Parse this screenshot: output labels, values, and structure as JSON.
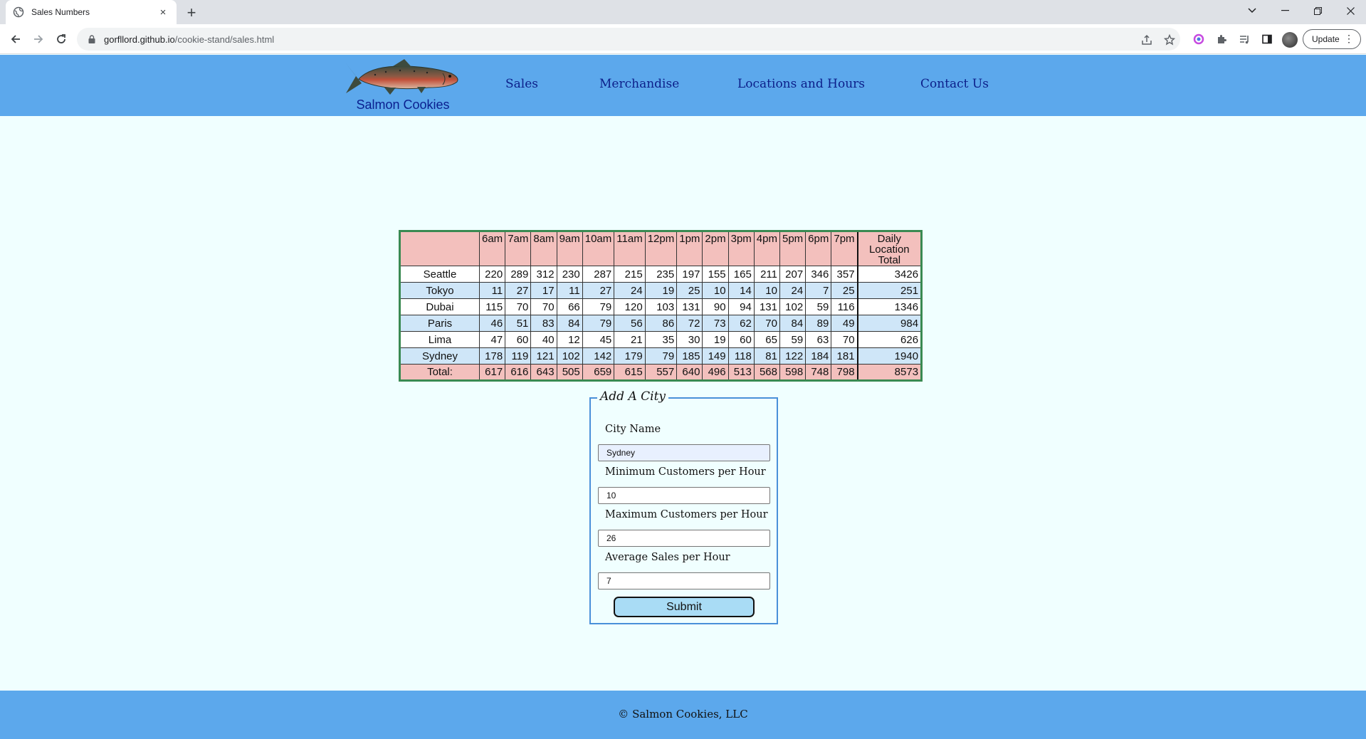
{
  "browser": {
    "tab_title": "Sales Numbers",
    "tab_close": "×",
    "new_tab": "+",
    "url_host": "gorfllord.github.io",
    "url_path": "/cookie-stand/sales.html",
    "update_label": "Update"
  },
  "header": {
    "logo_text": "Salmon Cookies",
    "nav": [
      "Sales",
      "Merchandise",
      "Locations and Hours",
      "Contact Us"
    ]
  },
  "table": {
    "hours": [
      "6am",
      "7am",
      "8am",
      "9am",
      "10am",
      "11am",
      "12pm",
      "1pm",
      "2pm",
      "3pm",
      "4pm",
      "5pm",
      "6pm",
      "7pm"
    ],
    "total_header": "Daily Location Total",
    "rows": [
      {
        "city": "Seattle",
        "values": [
          220,
          289,
          312,
          230,
          287,
          215,
          235,
          197,
          155,
          165,
          211,
          207,
          346,
          357
        ],
        "total": 3426
      },
      {
        "city": "Tokyo",
        "values": [
          11,
          27,
          17,
          11,
          27,
          24,
          19,
          25,
          10,
          14,
          10,
          24,
          7,
          25
        ],
        "total": 251
      },
      {
        "city": "Dubai",
        "values": [
          115,
          70,
          70,
          66,
          79,
          120,
          103,
          131,
          90,
          94,
          131,
          102,
          59,
          116
        ],
        "total": 1346
      },
      {
        "city": "Paris",
        "values": [
          46,
          51,
          83,
          84,
          79,
          56,
          86,
          72,
          73,
          62,
          70,
          84,
          89,
          49
        ],
        "total": 984
      },
      {
        "city": "Lima",
        "values": [
          47,
          60,
          40,
          12,
          45,
          21,
          35,
          30,
          19,
          60,
          65,
          59,
          63,
          70
        ],
        "total": 626
      },
      {
        "city": "Sydney",
        "values": [
          178,
          119,
          121,
          102,
          142,
          179,
          79,
          185,
          149,
          118,
          81,
          122,
          184,
          181
        ],
        "total": 1940
      }
    ],
    "totals_label": "Total:",
    "totals": [
      617,
      616,
      643,
      505,
      659,
      615,
      557,
      640,
      496,
      513,
      568,
      598,
      748,
      798
    ],
    "grand_total": 8573
  },
  "form": {
    "legend": "Add A City",
    "city_label": "City Name",
    "city_value": "Sydney",
    "min_label": "Minimum Customers per Hour",
    "min_value": "10",
    "max_label": "Maximum Customers per Hour",
    "max_value": "26",
    "avg_label": "Average Sales per Hour",
    "avg_value": "7",
    "submit_label": "Submit"
  },
  "footer": {
    "text": "© Salmon Cookies, LLC"
  }
}
